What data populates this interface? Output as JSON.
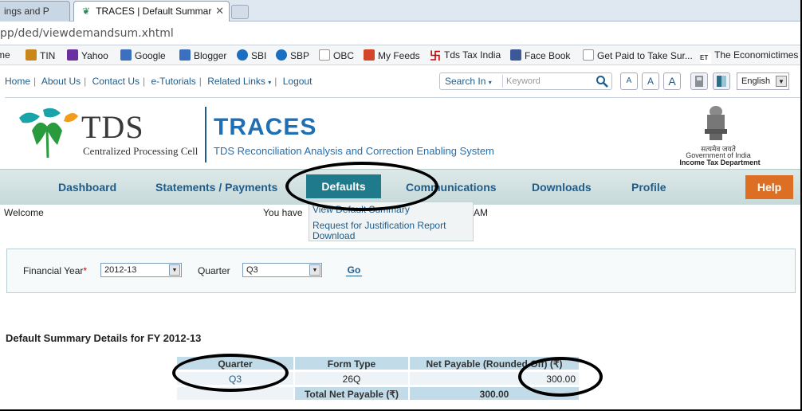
{
  "browser": {
    "tabs": [
      {
        "label": "ings and P",
        "active": false
      },
      {
        "label": "TRACES | Default Summar",
        "active": true
      }
    ],
    "url": "pp/ded/viewdemandsum.xhtml",
    "bookmarks": [
      {
        "label": "me",
        "icon": "partial-bookmark-icon"
      },
      {
        "label": "TIN",
        "icon": "tin-icon"
      },
      {
        "label": "Yahoo",
        "icon": "yahoo-icon"
      },
      {
        "label": "Google",
        "icon": "google-icon"
      },
      {
        "label": "Blogger",
        "icon": "blogger-icon"
      },
      {
        "label": "SBI",
        "icon": "sbi-icon"
      },
      {
        "label": "SBP",
        "icon": "sbp-icon"
      },
      {
        "label": "OBC",
        "icon": "page-icon"
      },
      {
        "label": "My Feeds",
        "icon": "feeds-icon"
      },
      {
        "label": "Tds Tax India",
        "icon": "tds-icon"
      },
      {
        "label": "Face Book",
        "icon": "facebook-icon"
      },
      {
        "label": "Get Paid to Take Sur...",
        "icon": "page-icon"
      },
      {
        "label": "The Economictimes",
        "icon": "et-icon"
      }
    ]
  },
  "site": {
    "toplinks": [
      "Home",
      "About Us",
      "Contact Us",
      "e-Tutorials",
      "Related Links",
      "Logout"
    ],
    "search": {
      "label": "Search In",
      "placeholder": "Keyword"
    },
    "font_sizes": [
      "A",
      "A",
      "A"
    ],
    "language": "English",
    "logo": {
      "word": "TDS",
      "sub": "Centralized Processing Cell"
    },
    "title": "TRACES",
    "subtitle": "TDS Reconciliation Analysis and Correction Enabling System",
    "emblem": {
      "hindi": "सत्यमेव जयते",
      "govt": "Government of India",
      "dept": "Income Tax Department"
    }
  },
  "menu": {
    "items": [
      "Dashboard",
      "Statements / Payments",
      "Defaults",
      "Communications",
      "Downloads",
      "Profile"
    ],
    "help": "Help",
    "active": "Defaults",
    "submenu": [
      "View Default Summary",
      "Request for Justification Report",
      "Download"
    ]
  },
  "status": {
    "welcome": "Welcome",
    "you_have": "You have",
    "am": "AM"
  },
  "filters": {
    "fy_label": "Financial Year",
    "fy_required_mark": "*",
    "fy_value": "2012-13",
    "quarter_label": "Quarter",
    "quarter_value": "Q3",
    "go_label": "Go"
  },
  "summary": {
    "title": "Default Summary Details for FY 2012-13",
    "headers": [
      "Quarter",
      "Form Type",
      "Net Payable (Rounded Off) (₹)"
    ],
    "rows": [
      [
        "Q3",
        "26Q",
        "300.00"
      ]
    ],
    "total_label": "Total Net Payable (₹)",
    "total_value": "300.00"
  }
}
